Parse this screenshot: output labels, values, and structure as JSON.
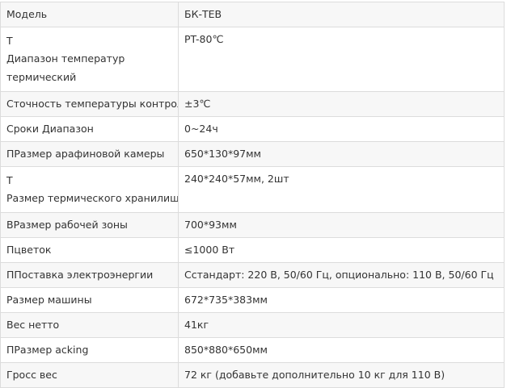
{
  "rows": [
    {
      "label": [
        "Модель"
      ],
      "value": "БК-TEB"
    },
    {
      "label": [
        "T",
        "Диапазон температур",
        "термический"
      ],
      "value": "PT-80℃"
    },
    {
      "label": [
        "Сточность температуры контроля"
      ],
      "value": "±3℃"
    },
    {
      "label": [
        "Сроки Диапазон"
      ],
      "value": "0~24ч"
    },
    {
      "label": [
        "ПРазмер арафиновой камеры"
      ],
      "value": "650*130*97мм"
    },
    {
      "label": [
        "T",
        "Размер термического хранилища"
      ],
      "value": "240*240*57мм, 2шт"
    },
    {
      "label": [
        "ВРазмер рабочей зоны"
      ],
      "value": "700*93мм"
    },
    {
      "label": [
        "Пцветок"
      ],
      "value": "≤1000 Вт"
    },
    {
      "label": [
        "ППоставка электроэнергии"
      ],
      "value": "Сстандарт: 220 В, 50/60 Гц, опционально: 110 В, 50/60 Гц"
    },
    {
      "label": [
        "Размер машины"
      ],
      "value": "672*735*383мм"
    },
    {
      "label": [
        "Вес нетто"
      ],
      "value": "41кг"
    },
    {
      "label": [
        "ПРазмер acking"
      ],
      "value": "850*880*650мм"
    },
    {
      "label": [
        "Гросс вес"
      ],
      "value": "72 кг (добавьте дополнительно 10 кг для 110 В)"
    }
  ]
}
